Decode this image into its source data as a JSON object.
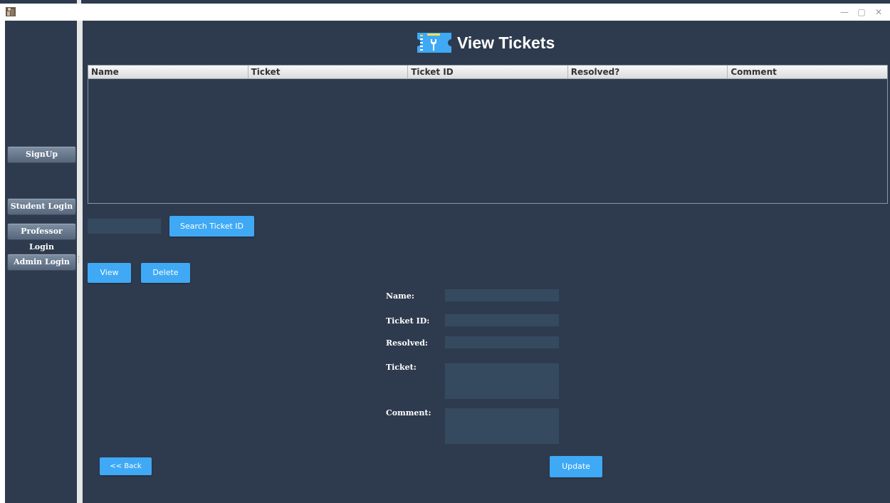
{
  "window": {
    "minimize_glyph": "—",
    "maximize_glyph": "▢",
    "close_glyph": "✕"
  },
  "sidebar": {
    "buttons": [
      {
        "label": "SignUp"
      },
      {
        "label": "Student Login"
      },
      {
        "label": "Professor Login"
      },
      {
        "label": "Admin Login"
      }
    ]
  },
  "header": {
    "title": "View Tickets",
    "icon": "ticket-wrench-icon"
  },
  "table": {
    "columns": [
      "Name",
      "Ticket",
      "Ticket ID",
      "Resolved?",
      "Comment"
    ],
    "rows": []
  },
  "search": {
    "value": "",
    "button_label": "Search Ticket ID"
  },
  "actions": {
    "view_label": "View",
    "delete_label": "Delete"
  },
  "form": {
    "name_label": "Name:",
    "ticket_id_label": "Ticket ID:",
    "resolved_label": "Resolved:",
    "ticket_label": "Ticket:",
    "comment_label": "Comment:",
    "name_value": "",
    "ticket_id_value": "",
    "resolved_value": "",
    "ticket_value": "",
    "comment_value": ""
  },
  "footer": {
    "back_label": "<< Back",
    "update_label": "Update"
  },
  "colors": {
    "background": "#2e3b4e",
    "accent": "#3fa9f5",
    "field": "#364a5f"
  }
}
